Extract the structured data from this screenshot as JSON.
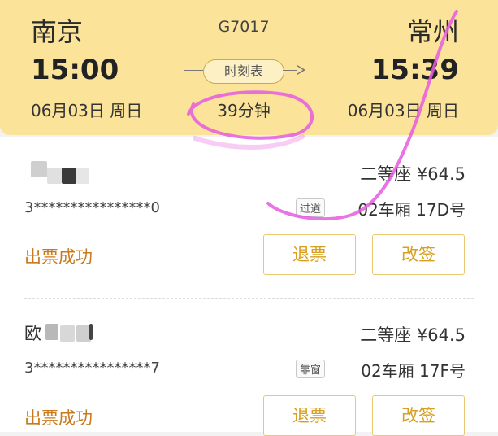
{
  "train": {
    "from_city": "南京",
    "to_city": "常州",
    "number": "G7017",
    "depart_time": "15:00",
    "arrive_time": "15:39",
    "depart_date": "06月03日 周日",
    "arrive_date": "06月03日 周日",
    "duration": "39分钟",
    "schedule_label": "时刻表"
  },
  "passengers": [
    {
      "name_prefix": "",
      "seat_class": "二等座 ¥64.5",
      "id_number": "3****************0",
      "seat_tag": "过道",
      "coach_seat": "02车厢 17D号",
      "status": "出票成功",
      "refund_label": "退票",
      "change_label": "改签"
    },
    {
      "name_prefix": "欧",
      "seat_class": "二等座 ¥64.5",
      "id_number": "3****************7",
      "seat_tag": "靠窗",
      "coach_seat": "02车厢 17F号",
      "status": "出票成功",
      "refund_label": "退票",
      "change_label": "改签"
    }
  ],
  "colors": {
    "header_bg": "#fbe49a",
    "status_text": "#c97a1c",
    "button_text": "#d8a020",
    "annotation": "#e65ae0"
  }
}
